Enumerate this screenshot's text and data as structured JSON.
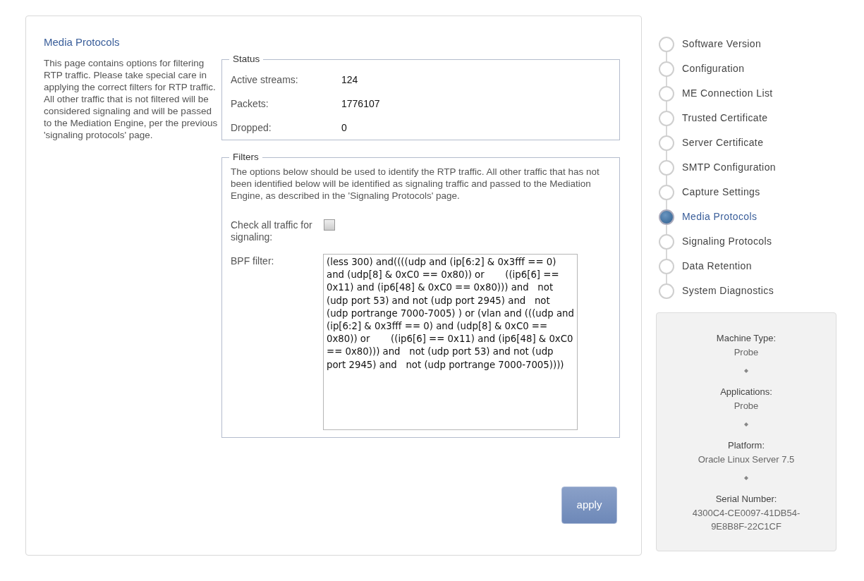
{
  "page": {
    "title": "Media Protocols",
    "description": "This page contains options for filtering RTP traffic. Please take special care in applying the correct filters for RTP traffic. All other traffic that is not filtered will be considered signaling and will be passed to the Mediation Engine, per the previous 'signaling protocols' page."
  },
  "status": {
    "legend": "Status",
    "rows": [
      {
        "label": "Active streams:",
        "value": "124"
      },
      {
        "label": "Packets:",
        "value": "1776107"
      },
      {
        "label": "Dropped:",
        "value": "0"
      }
    ]
  },
  "filters": {
    "legend": "Filters",
    "description": "The options below should be used to identify the RTP traffic. All other traffic that has not been identified below will be identified as signaling traffic and passed to the Mediation Engine, as described in the 'Signaling Protocols' page.",
    "check_all": {
      "label": "Check all traffic for signaling:",
      "checked": false
    },
    "bpf": {
      "label": "BPF filter:",
      "value": "(less 300) and((((udp and (ip[6:2] & 0x3fff == 0) and (udp[8] & 0xC0 == 0x80)) or       ((ip6[6] == 0x11) and (ip6[48] & 0xC0 == 0x80))) and   not (udp port 53) and not (udp port 2945) and   not (udp portrange 7000-7005) ) or (vlan and (((udp and (ip[6:2] & 0x3fff == 0) and (udp[8] & 0xC0 == 0x80)) or       ((ip6[6] == 0x11) and (ip6[48] & 0xC0 == 0x80))) and   not (udp port 53) and not (udp port 2945) and   not (udp portrange 7000-7005))))"
    }
  },
  "apply_button": {
    "label": "apply",
    "disabled": true
  },
  "steps": [
    {
      "label": "Software Version",
      "selected": false
    },
    {
      "label": "Configuration",
      "selected": false
    },
    {
      "label": "ME Connection List",
      "selected": false
    },
    {
      "label": "Trusted Certificate",
      "selected": false
    },
    {
      "label": "Server Certificate",
      "selected": false
    },
    {
      "label": "SMTP Configuration",
      "selected": false
    },
    {
      "label": "Capture Settings",
      "selected": false
    },
    {
      "label": "Media Protocols",
      "selected": true
    },
    {
      "label": "Signaling Protocols",
      "selected": false
    },
    {
      "label": "Data Retention",
      "selected": false
    },
    {
      "label": "System Diagnostics",
      "selected": false
    }
  ],
  "machine_info": [
    {
      "label": "Machine Type:",
      "value": "Probe"
    },
    {
      "label": "Applications:",
      "value": "Probe"
    },
    {
      "label": "Platform:",
      "value": "Oracle Linux Server 7.5"
    },
    {
      "label": "Serial Number:",
      "value": "4300C4-CE0097-41DB54-9E8B8F-22C1CF"
    }
  ]
}
